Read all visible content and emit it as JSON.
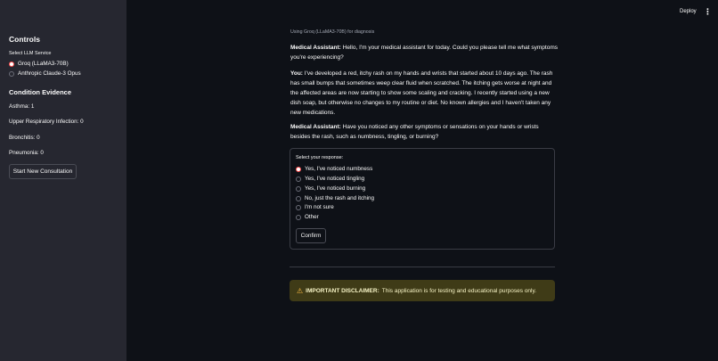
{
  "header": {
    "deploy_label": "Deploy",
    "menu_icon": "kebab-menu-icon"
  },
  "sidebar": {
    "title": "Controls",
    "llm_select_label": "Select LLM Service",
    "llm_options": [
      {
        "label": "Groq (LLaMA3-70B)",
        "selected": true
      },
      {
        "label": "Anthropic Claude-3 Opus",
        "selected": false
      }
    ],
    "evidence_heading": "Condition Evidence",
    "evidence": [
      "Asthma: 1",
      "Upper Respiratory Infection: 0",
      "Bronchitis: 0",
      "Pneumonia: 0"
    ],
    "new_consultation_label": "Start New Consultation"
  },
  "main": {
    "using_text": "Using Groq (LLaMA3-70B) for diagnosis",
    "messages": [
      {
        "speaker": "Medical Assistant:",
        "text": " Hello, I'm your medical assistant for today. Could you please tell me what symptoms you're experiencing?"
      },
      {
        "speaker": "You:",
        "text": " I've developed a red, itchy rash on my hands and wrists that started about 10 days ago. The rash has small bumps that sometimes weep clear fluid when scratched. The itching gets worse at night and the affected areas are now starting to show some scaling and cracking. I recently started using a new dish soap, but otherwise no changes to my routine or diet. No known allergies and I haven't taken any new medications."
      },
      {
        "speaker": "Medical Assistant:",
        "text": " Have you noticed any other symptoms or sensations on your hands or wrists besides the rash, such as numbness, tingling, or burning?"
      }
    ],
    "response_label": "Select your response:",
    "responses": [
      {
        "label": "Yes, I've noticed numbness",
        "selected": true
      },
      {
        "label": "Yes, I've noticed tingling",
        "selected": false
      },
      {
        "label": "Yes, I've noticed burning",
        "selected": false
      },
      {
        "label": "No, just the rash and itching",
        "selected": false
      },
      {
        "label": "I'm not sure",
        "selected": false
      },
      {
        "label": "Other",
        "selected": false
      }
    ],
    "confirm_label": "Confirm",
    "disclaimer": {
      "icon": "warning-icon",
      "title": "IMPORTANT DISCLAIMER:",
      "text": "This application is for testing and educational purposes only."
    }
  },
  "colors": {
    "background": "#0e1117",
    "sidebar": "#262730",
    "accent": "#ff4b4b",
    "warning_bg": "#3f3b17"
  }
}
